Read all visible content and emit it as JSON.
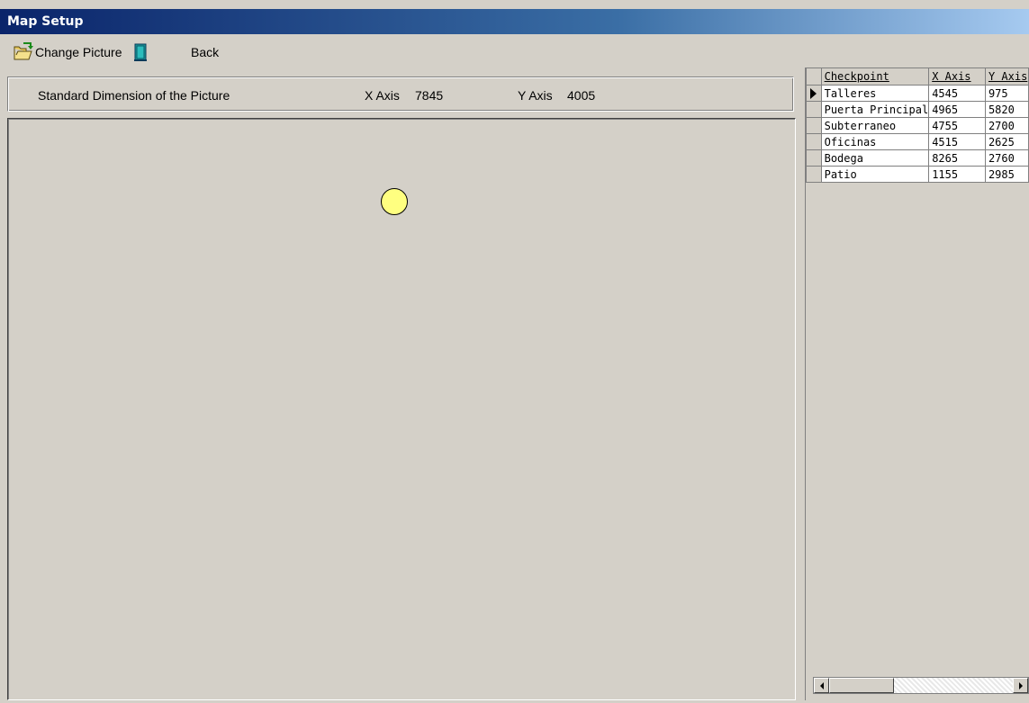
{
  "window": {
    "title": "Map Setup"
  },
  "toolbar": {
    "change_picture_label": "Change Picture",
    "back_label": "Back"
  },
  "info": {
    "label": "Standard Dimension of the Picture",
    "x_axis_label": "X Axis",
    "x_axis_value": "7845",
    "y_axis_label": "Y Axis",
    "y_axis_value": "4005"
  },
  "grid": {
    "columns": [
      "Checkpoint",
      "X Axis",
      "Y Axis"
    ],
    "rows": [
      {
        "checkpoint": "Talleres",
        "x": "4545",
        "y": "975",
        "selected": true
      },
      {
        "checkpoint": "Puerta Principal",
        "x": "4965",
        "y": "5820",
        "selected": false
      },
      {
        "checkpoint": "Subterraneo",
        "x": "4755",
        "y": "2700",
        "selected": false
      },
      {
        "checkpoint": "Oficinas",
        "x": "4515",
        "y": "2625",
        "selected": false
      },
      {
        "checkpoint": "Bodega",
        "x": "8265",
        "y": "2760",
        "selected": false
      },
      {
        "checkpoint": "Patio",
        "x": "1155",
        "y": "2985",
        "selected": false
      }
    ]
  },
  "icons": {
    "change_picture": "folder-open-icon",
    "back": "exit-door-icon",
    "marker_color": "#ffff80"
  }
}
